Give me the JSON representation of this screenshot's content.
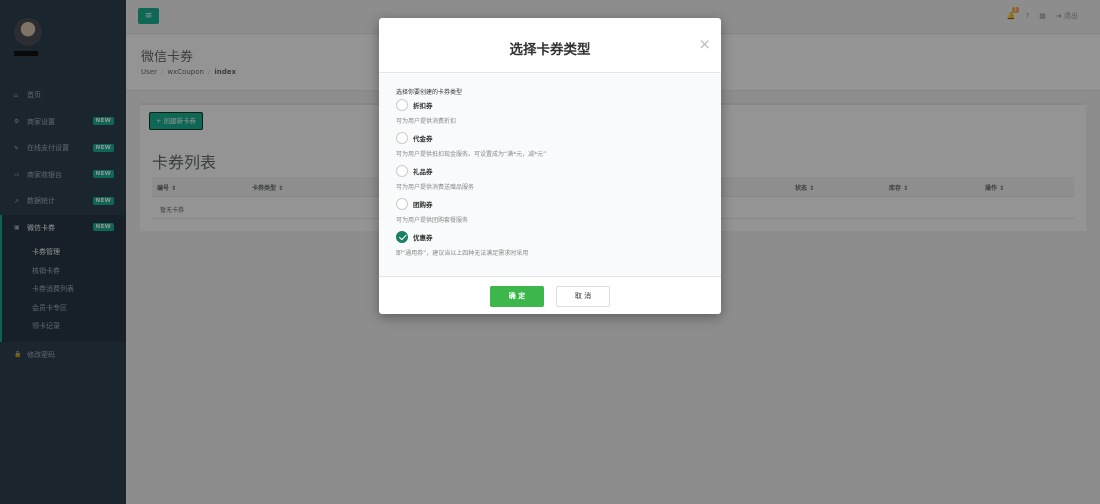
{
  "sidebar": {
    "items": [
      {
        "icon": "home-icon",
        "glyph": "⌂",
        "label": "首页",
        "badge": ""
      },
      {
        "icon": "cogs-icon",
        "glyph": "⚙",
        "label": "商家设置",
        "badge": "NEW"
      },
      {
        "icon": "wrench-icon",
        "glyph": "✎",
        "label": "在线支付设置",
        "badge": "NEW"
      },
      {
        "icon": "laptop-icon",
        "glyph": "▭",
        "label": "商家收银台",
        "badge": "NEW"
      },
      {
        "icon": "line-chart-icon",
        "glyph": "↗",
        "label": "数据统计",
        "badge": "NEW"
      },
      {
        "icon": "ticket-icon",
        "glyph": "▣",
        "label": "微信卡券",
        "badge": "NEW"
      }
    ],
    "subitems": [
      "卡券管理",
      "核销卡券",
      "卡券消费列表",
      "会员卡专区",
      "领卡记录"
    ],
    "bottom_item": {
      "icon": "lock-icon",
      "glyph": "🔒",
      "label": "修改密码"
    }
  },
  "topbar": {
    "menu_glyph": "≡",
    "bell_count": "1",
    "logout_label": "退出"
  },
  "page": {
    "title": "微信卡券",
    "breadcrumb": [
      "User",
      "wxCoupon",
      "index"
    ]
  },
  "card": {
    "create_label": "+ 创建新卡券",
    "list_title": "卡券列表",
    "columns": [
      "编号 ⇕",
      "卡券类型 ⇕",
      "状态 ⇕",
      "库存 ⇕",
      "操作 ⇕"
    ],
    "empty_text": "暂无卡券"
  },
  "modal": {
    "title": "选择卡券类型",
    "close_glyph": "×",
    "prompt": "选择你要创建的卡券类型",
    "options": [
      {
        "name": "折扣券",
        "desc": "可为用户提供消费折扣",
        "checked": false
      },
      {
        "name": "代金券",
        "desc": "可为用户提供抵扣现金服务。可设置成为“满*元，减*元”",
        "checked": false
      },
      {
        "name": "礼品券",
        "desc": "可为用户提供消费送赠品服务",
        "checked": false
      },
      {
        "name": "团购券",
        "desc": "可为用户提供团购套餐服务",
        "checked": false
      },
      {
        "name": "优惠券",
        "desc": "即“通用券”，建议当以上四种无法满足需求时采用",
        "checked": true
      }
    ],
    "ok_label": "确 定",
    "cancel_label": "取 消"
  },
  "colors": {
    "sidebar_bg": "#2f4050",
    "accent": "#1ab394",
    "checked_radio": "#1a7f64",
    "ok_button": "#3db74b"
  }
}
